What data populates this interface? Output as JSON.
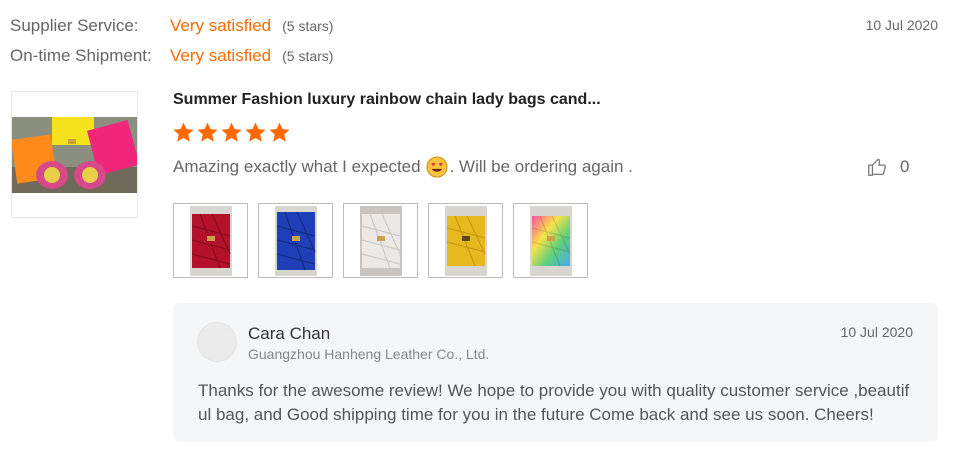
{
  "ratings": [
    {
      "label": "Supplier Service:",
      "value": "Very satisfied",
      "stars_text": "(5 stars)"
    },
    {
      "label": "On-time Shipment:",
      "value": "Very satisfied",
      "stars_text": "(5 stars)"
    }
  ],
  "review": {
    "date": "10 Jul 2020",
    "product_title": "Summer Fashion luxury rainbow chain lady bags cand...",
    "rating": 5,
    "comment_before": "Amazing exactly what I expected",
    "comment_emoji": "heart-eyes-emoji",
    "comment_after": ". Will be ordering again .",
    "likes": "0",
    "photos": [
      {
        "icon": "red-bag-photo",
        "color": "#b3122a"
      },
      {
        "icon": "blue-bag-photo",
        "color": "#1f3fb8"
      },
      {
        "icon": "white-bag-photo",
        "color": "#e9e6e4"
      },
      {
        "icon": "yellow-bag-photo",
        "color": "#e8b820"
      },
      {
        "icon": "rainbow-bag-photo",
        "color": "#5fd07a"
      }
    ]
  },
  "reply": {
    "name": "Cara Chan",
    "company": "Guangzhou Hanheng Leather Co., Ltd.",
    "date": "10 Jul 2020",
    "text": "Thanks for the awesome review! We hope to provide you with quality customer service ,beautiful bag, and Good shipping time for you in the future Come back and see us soon. Cheers!"
  },
  "colors": {
    "accent": "#ff6a00",
    "text_muted": "#666666",
    "reply_bg": "#f5f6f7"
  }
}
